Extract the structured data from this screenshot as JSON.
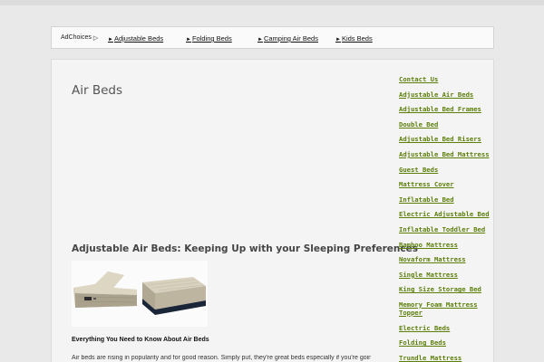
{
  "ad_bar": {
    "adchoices_label": "AdChoices",
    "links": [
      {
        "arrow": "►",
        "label": "Adjustable Beds"
      },
      {
        "arrow": "►",
        "label": "Folding Beds"
      },
      {
        "arrow": "►",
        "label": "Camping Air Beds"
      },
      {
        "arrow": "►",
        "label": "Kids Beds"
      }
    ]
  },
  "main": {
    "page_title": "Air Beds",
    "article_heading": "Adjustable Air Beds: Keeping Up with your Sleeping Preferences",
    "subheading": "Everything You Need to Know About Air Beds",
    "body_text": "Air beds are rising in popularity and for good reason. Simply put, they're great beds especially if you're going to"
  },
  "sidebar": {
    "links": [
      "Contact Us",
      "Adjustable Air Beds",
      "Adjustable Bed Frames",
      "Double Bed",
      "Adjustable Bed Risers",
      "Adjustable Bed Mattress",
      "Guest Beds",
      "Mattress Cover",
      "Inflatable Bed",
      "Electric Adjustable Bed",
      "Inflatable Toddler Bed",
      "Bamboo Mattress",
      "Novaform Mattress",
      "Single Mattress",
      "King Size Storage Bed",
      "Memory Foam Mattress Topper",
      "Electric Beds",
      "Folding Beds",
      "Trundle Mattress"
    ]
  },
  "colors": {
    "sidebar_link": "#5c7f0a",
    "background": "#e9e9e9",
    "content_bg": "#f4f4f4"
  }
}
